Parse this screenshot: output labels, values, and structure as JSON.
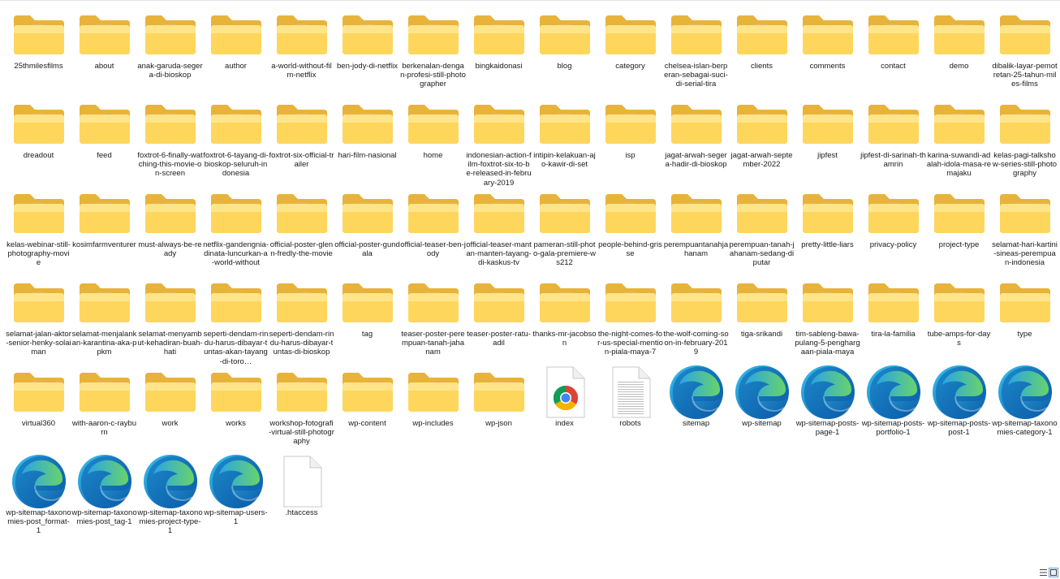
{
  "items": [
    {
      "name": "25thmilesfilms",
      "type": "folder-doc"
    },
    {
      "name": "about",
      "type": "folder-doc"
    },
    {
      "name": "anak-garuda-segera-di-bioskop",
      "type": "folder-doc"
    },
    {
      "name": "author",
      "type": "folder"
    },
    {
      "name": "a-world-without-film-netflix",
      "type": "folder-doc"
    },
    {
      "name": "ben-jody-di-netflix",
      "type": "folder-doc"
    },
    {
      "name": "berkenalan-dengan-profesi-still-photographer",
      "type": "folder-doc"
    },
    {
      "name": "bingkaidonasi",
      "type": "folder-doc"
    },
    {
      "name": "blog",
      "type": "folder-doc"
    },
    {
      "name": "category",
      "type": "folder"
    },
    {
      "name": "chelsea-islan-berperan-sebagai-suci-di-serial-tira",
      "type": "folder-doc"
    },
    {
      "name": "clients",
      "type": "folder-doc"
    },
    {
      "name": "comments",
      "type": "folder"
    },
    {
      "name": "contact",
      "type": "folder-doc"
    },
    {
      "name": "demo",
      "type": "folder-doc"
    },
    {
      "name": "dibalik-layar-pemotretan-25-tahun-miles-films",
      "type": "folder-doc"
    },
    {
      "name": "dreadout",
      "type": "folder-doc"
    },
    {
      "name": "feed",
      "type": "folder-edge"
    },
    {
      "name": "foxtrot-6-finally-watching-this-movie-on-screen",
      "type": "folder-doc"
    },
    {
      "name": "foxtrot-6-tayang-di-bioskop-seluruh-indonesia",
      "type": "folder-doc"
    },
    {
      "name": "foxtrot-six-official-trailer",
      "type": "folder-doc"
    },
    {
      "name": "hari-film-nasional",
      "type": "folder-doc"
    },
    {
      "name": "home",
      "type": "folder"
    },
    {
      "name": "indonesian-action-film-foxtrot-six-to-be-released-in-february-2019",
      "type": "folder-doc"
    },
    {
      "name": "intipin-kelakuan-ajo-kawir-di-set",
      "type": "folder-doc"
    },
    {
      "name": "isp",
      "type": "folder-doc"
    },
    {
      "name": "jagat-arwah-segera-hadir-di-bioskop",
      "type": "folder-doc"
    },
    {
      "name": "jagat-arwah-september-2022",
      "type": "folder-doc"
    },
    {
      "name": "jipfest",
      "type": "folder-doc"
    },
    {
      "name": "jipfest-di-sarinah-thamrin",
      "type": "folder-doc"
    },
    {
      "name": "karina-suwandi-adalah-idola-masa-remajaku",
      "type": "folder-doc"
    },
    {
      "name": "kelas-pagi-talkshow-series-still-photography",
      "type": "folder-doc"
    },
    {
      "name": "kelas-webinar-still-photography-movie",
      "type": "folder-doc"
    },
    {
      "name": "kosimfarmventurer",
      "type": "folder-doc"
    },
    {
      "name": "must-always-be-ready",
      "type": "folder-doc"
    },
    {
      "name": "netflix-gandengnia-dinata-luncurkan-a-world-without",
      "type": "folder-doc"
    },
    {
      "name": "official-poster-glenn-fredly-the-movie",
      "type": "folder-doc"
    },
    {
      "name": "official-poster-gundala",
      "type": "folder-doc"
    },
    {
      "name": "official-teaser-ben-jody",
      "type": "folder-doc"
    },
    {
      "name": "official-teaser-mantan-manten-tayang-di-kaskus-tv",
      "type": "folder-doc"
    },
    {
      "name": "pameran-still-photo-gala-premiere-ws212",
      "type": "folder-doc"
    },
    {
      "name": "people-behind-grisse",
      "type": "folder-doc"
    },
    {
      "name": "perempuantanahjahanam",
      "type": "folder-doc"
    },
    {
      "name": "perempuan-tanah-jahanam-sedang-diputar",
      "type": "folder-doc"
    },
    {
      "name": "pretty-little-liars",
      "type": "folder-doc"
    },
    {
      "name": "privacy-policy",
      "type": "folder-doc"
    },
    {
      "name": "project-type",
      "type": "folder"
    },
    {
      "name": "selamat-hari-kartini-sineas-perempuan-indonesia",
      "type": "folder-doc"
    },
    {
      "name": "selamat-jalan-aktor-senior-henky-solaiman",
      "type": "folder-doc"
    },
    {
      "name": "selamat-menjalankan-karantina-aka-ppkm",
      "type": "folder-doc"
    },
    {
      "name": "selamat-menyambut-kehadiran-buah-hati",
      "type": "folder-doc"
    },
    {
      "name": "seperti-dendam-rindu-harus-dibayar-tuntas-akan-tayang-di-toro…",
      "type": "folder-doc"
    },
    {
      "name": "seperti-dendam-rindu-harus-dibayar-tuntas-di-bioskop",
      "type": "folder-doc"
    },
    {
      "name": "tag",
      "type": "folder"
    },
    {
      "name": "teaser-poster-perempuan-tanah-jahanam",
      "type": "folder-doc"
    },
    {
      "name": "teaser-poster-ratu-adil",
      "type": "folder-doc"
    },
    {
      "name": "thanks-mr-jacobson",
      "type": "folder-doc"
    },
    {
      "name": "the-night-comes-for-us-special-mention-piala-maya-7",
      "type": "folder-doc"
    },
    {
      "name": "the-wolf-coming-soon-in-february-2019",
      "type": "folder-doc"
    },
    {
      "name": "tiga-srikandi",
      "type": "folder-doc"
    },
    {
      "name": "tim-sableng-bawa-pulang-5-penghargaan-piala-maya",
      "type": "folder-doc"
    },
    {
      "name": "tira-la-familia",
      "type": "folder-doc"
    },
    {
      "name": "tube-amps-for-days",
      "type": "folder-doc"
    },
    {
      "name": "type",
      "type": "folder"
    },
    {
      "name": "virtual360",
      "type": "folder-doc"
    },
    {
      "name": "with-aaron-c-rayburn",
      "type": "folder-doc"
    },
    {
      "name": "work",
      "type": "folder"
    },
    {
      "name": "works",
      "type": "folder-doc"
    },
    {
      "name": "workshop-fotografi-virtual-still-photography",
      "type": "folder-doc"
    },
    {
      "name": "wp-content",
      "type": "folder"
    },
    {
      "name": "wp-includes",
      "type": "folder-edge"
    },
    {
      "name": "wp-json",
      "type": "folder-doc"
    },
    {
      "name": "index",
      "type": "chrome-file"
    },
    {
      "name": "robots",
      "type": "text-file"
    },
    {
      "name": "sitemap",
      "type": "edge-file"
    },
    {
      "name": "wp-sitemap",
      "type": "edge-file"
    },
    {
      "name": "wp-sitemap-posts-page-1",
      "type": "edge-file"
    },
    {
      "name": "wp-sitemap-posts-portfolio-1",
      "type": "edge-file"
    },
    {
      "name": "wp-sitemap-posts-post-1",
      "type": "edge-file"
    },
    {
      "name": "wp-sitemap-taxonomies-category-1",
      "type": "edge-file"
    },
    {
      "name": "wp-sitemap-taxonomies-post_format-1",
      "type": "edge-file"
    },
    {
      "name": "wp-sitemap-taxonomies-post_tag-1",
      "type": "edge-file"
    },
    {
      "name": "wp-sitemap-taxonomies-project-type-1",
      "type": "edge-file"
    },
    {
      "name": "wp-sitemap-users-1",
      "type": "edge-file"
    },
    {
      "name": ".htaccess",
      "type": "blank-file"
    }
  ],
  "view_buttons": [
    {
      "name": "details-view-icon",
      "active": false
    },
    {
      "name": "large-icons-view-icon",
      "active": true
    }
  ],
  "colors": {
    "folder_back": "#e8b33a",
    "folder_front": "#ffd65c",
    "folder_front_light": "#ffe48a",
    "accent_select": "#6fa8dc"
  }
}
